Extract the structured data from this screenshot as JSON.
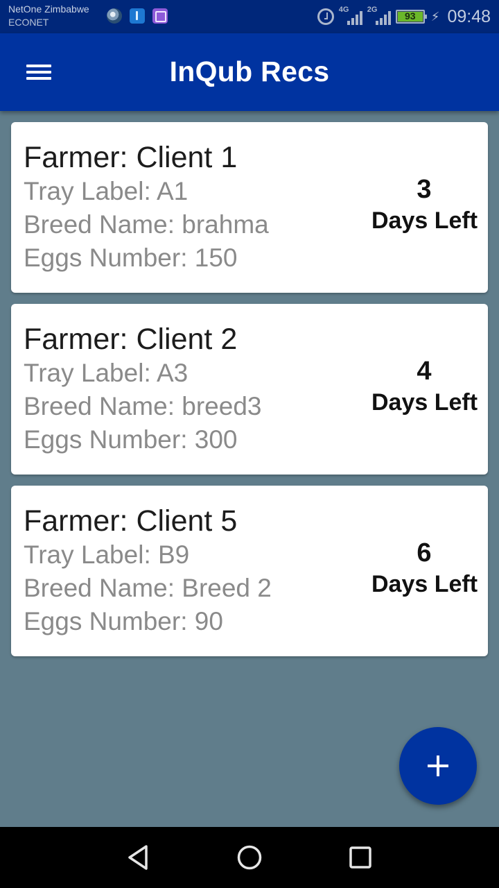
{
  "status_bar": {
    "carrier_primary": "NetOne Zimbabwe",
    "carrier_secondary": "ECONET",
    "network_1": "4G",
    "network_2": "2G",
    "battery_percent": "93",
    "time": "09:48",
    "notification_icons": [
      "globe-icon",
      "usb-icon",
      "gallery-icon"
    ]
  },
  "app_bar": {
    "title": "InQub Recs",
    "menu_icon": "hamburger-menu-icon"
  },
  "records": [
    {
      "farmer": "Farmer: Client 1",
      "tray": "Tray Label: A1",
      "breed": "Breed Name: brahma",
      "eggs": "Eggs Number: 150",
      "days": "3",
      "days_label": "Days Left"
    },
    {
      "farmer": "Farmer: Client 2",
      "tray": "Tray Label: A3",
      "breed": "Breed Name: breed3",
      "eggs": "Eggs Number: 300",
      "days": "4",
      "days_label": "Days Left"
    },
    {
      "farmer": "Farmer: Client 5",
      "tray": "Tray Label: B9",
      "breed": "Breed Name: Breed 2",
      "eggs": "Eggs Number: 90",
      "days": "6",
      "days_label": "Days Left"
    }
  ],
  "fab": {
    "icon": "plus-icon"
  },
  "colors": {
    "primary": "#0033a0",
    "status_bar": "#00277a",
    "background": "#607d8b",
    "card": "#ffffff",
    "battery": "#6bb82a"
  }
}
